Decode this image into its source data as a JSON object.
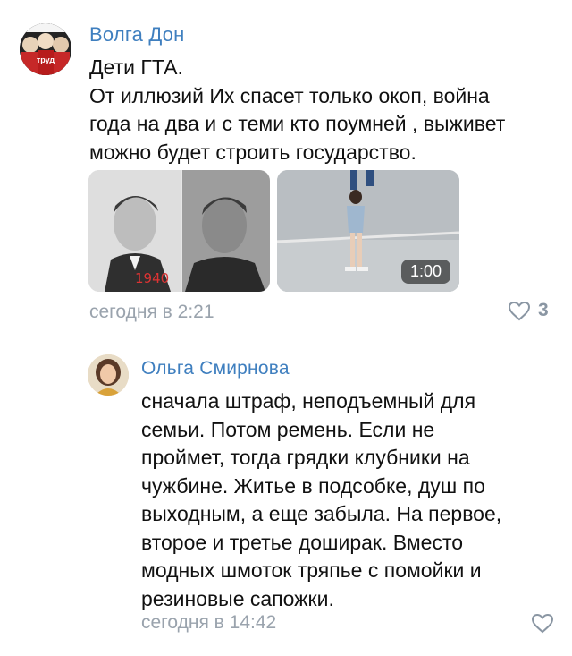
{
  "comments": [
    {
      "author": "Волга Дон",
      "text": "Дети ГТА.\nОт иллюзий Их спасет только окоп, война\nгода на два и с теми кто поумней , выживет\nможно будет строить государство.",
      "time": "сегодня в 2:21",
      "likes": "3",
      "photo_year_label": "1940",
      "video_duration": "1:00",
      "avatar_text": "труд",
      "icons": [
        "heart-icon"
      ]
    },
    {
      "author": "Ольга Смирнова",
      "text": "сначала штраф, неподъемный для\nсемьи. Потом ремень. Если не\nпроймет, тогда грядки клубники на\nчужбине. Житье в подсобке, душ по\nвыходным, а еще забыла. На первое,\nвторое и третье доширак. Вместо\nмодных шмоток тряпье с помойки и\nрезиновые сапожки.",
      "time": "сегодня в 14:42",
      "icons": [
        "heart-icon"
      ]
    }
  ],
  "colors": {
    "author": "#3f7fbf",
    "meta": "#9aa3ad",
    "icon": "#8a96a3"
  }
}
